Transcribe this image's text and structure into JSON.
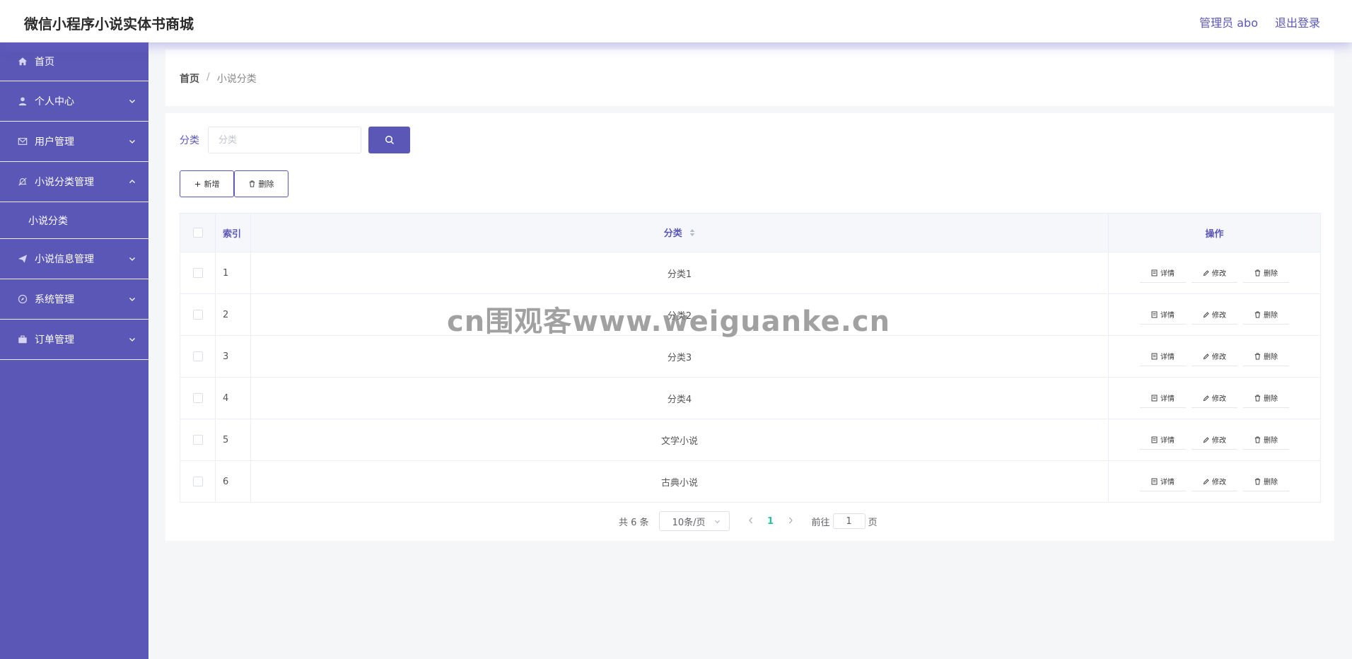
{
  "header": {
    "app_title": "微信小程序小说实体书商城",
    "user_label": "管理员 abo",
    "logout_label": "退出登录"
  },
  "sidebar": {
    "items": [
      {
        "label": "首页",
        "icon": "home-icon"
      },
      {
        "label": "个人中心",
        "icon": "user-icon"
      },
      {
        "label": "用户管理",
        "icon": "mail-icon"
      },
      {
        "label": "小说分类管理",
        "icon": "bell-off-icon"
      },
      {
        "label": "小说信息管理",
        "icon": "send-icon"
      },
      {
        "label": "系统管理",
        "icon": "compass-icon"
      },
      {
        "label": "订单管理",
        "icon": "briefcase-icon"
      }
    ],
    "sub_item_label": "小说分类"
  },
  "breadcrumb": {
    "home": "首页",
    "separator": "/",
    "current": "小说分类"
  },
  "search": {
    "label": "分类",
    "placeholder": "分类"
  },
  "actions": {
    "add_label": "新增",
    "delete_label": "删除"
  },
  "table": {
    "headers": {
      "index": "索引",
      "category": "分类",
      "operations": "操作"
    },
    "rows": [
      {
        "index": "1",
        "category": "分类1"
      },
      {
        "index": "2",
        "category": "分类2"
      },
      {
        "index": "3",
        "category": "分类3"
      },
      {
        "index": "4",
        "category": "分类4"
      },
      {
        "index": "5",
        "category": "文学小说"
      },
      {
        "index": "6",
        "category": "古典小说"
      }
    ],
    "row_actions": {
      "detail": "详情",
      "edit": "修改",
      "delete": "删除"
    }
  },
  "pagination": {
    "total": "共 6 条",
    "page_size": "10条/页",
    "current_page": "1",
    "goto_prefix": "前往",
    "goto_value": "1",
    "goto_suffix": "页"
  },
  "watermark": "cn围观客www.weiguanke.cn",
  "colors": {
    "accent": "#5b57b6",
    "active_page": "#22c4a4"
  }
}
